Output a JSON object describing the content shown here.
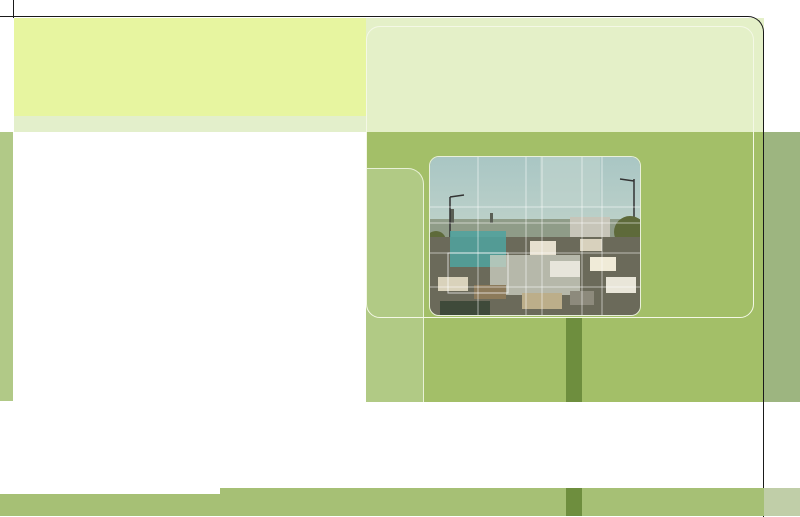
{
  "colors": {
    "lime": "#e7f5a0",
    "pale_green": "#e4f0c8",
    "green": "#a3bf68",
    "light_green": "#b1ca85",
    "dark_green": "#6e8e3e",
    "sage": "#9db580"
  },
  "photo": {
    "subject": "traffic-jam-photo"
  }
}
